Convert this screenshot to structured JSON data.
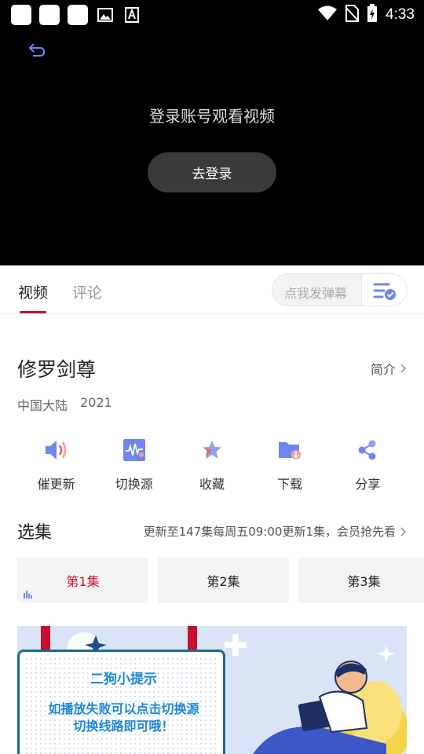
{
  "status_bar": {
    "time": "4:33"
  },
  "player": {
    "login_message": "登录账号观看视频",
    "login_button": "去登录"
  },
  "tabs": {
    "video": "视频",
    "comment": "评论",
    "danmaku_placeholder": "点我发弹幕"
  },
  "show": {
    "title": "修罗剑尊",
    "intro_link": "简介",
    "region": "中国大陆",
    "year": "2021"
  },
  "actions": [
    {
      "label": "催更新",
      "icon": "speaker-icon"
    },
    {
      "label": "切换源",
      "icon": "waveform-icon"
    },
    {
      "label": "收藏",
      "icon": "star-icon"
    },
    {
      "label": "下载",
      "icon": "download-folder-icon"
    },
    {
      "label": "分享",
      "icon": "share-icon"
    }
  ],
  "episodes": {
    "heading": "选集",
    "update_info": "更新至147集每周五09:00更新1集，会员抢先看",
    "items": [
      {
        "label": "第1集",
        "active": true
      },
      {
        "label": "第2集",
        "active": false
      },
      {
        "label": "第3集",
        "active": false
      }
    ]
  },
  "banner": {
    "line1": "二狗小提示",
    "line2": "如播放失败可以点击切换源",
    "line3": "切换线路即可哦！"
  },
  "colors": {
    "accent": "#c8102e",
    "icon_blue": "#6f86f0",
    "banner_text": "#1e88d8"
  }
}
